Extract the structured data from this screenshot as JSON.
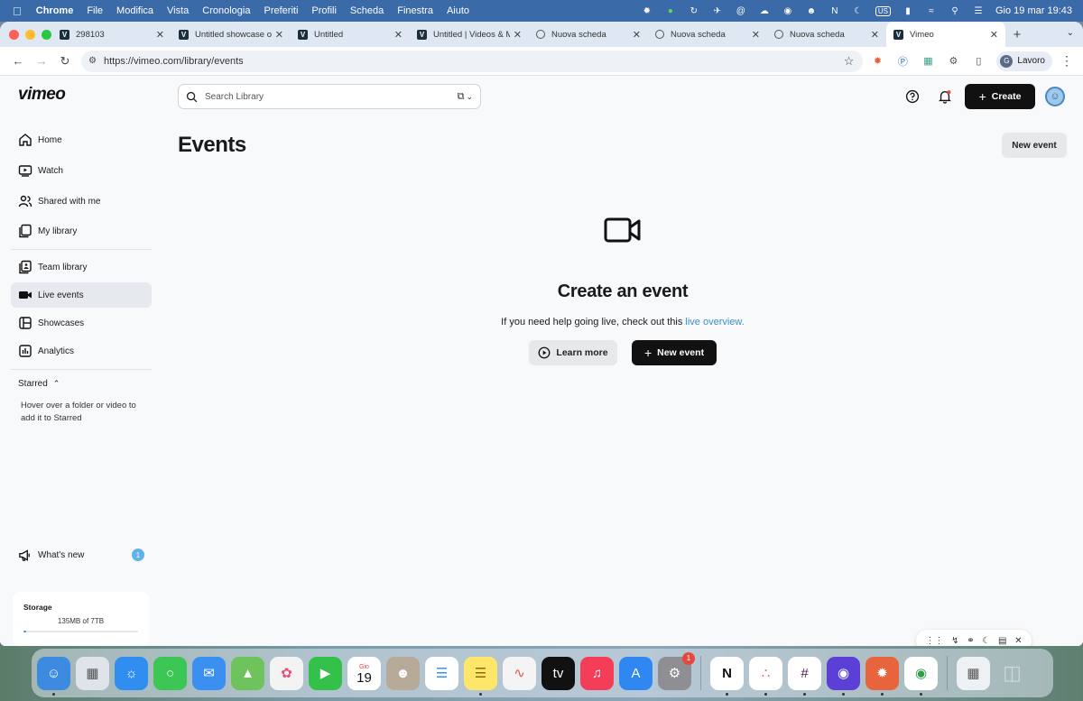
{
  "menubar": {
    "app": "Chrome",
    "items": [
      "File",
      "Modifica",
      "Vista",
      "Cronologia",
      "Preferiti",
      "Profili",
      "Scheda",
      "Finestra",
      "Aiuto"
    ],
    "input_source": "US",
    "datetime": "Gio 19 mar  19:43"
  },
  "tabs": [
    {
      "title": "298103",
      "favicon": "vimeo"
    },
    {
      "title": "Untitled showcase o",
      "favicon": "vimeo"
    },
    {
      "title": "Untitled",
      "favicon": "vimeo"
    },
    {
      "title": "Untitled | Videos & M",
      "favicon": "vimeo"
    },
    {
      "title": "Nuova scheda",
      "favicon": "chrome"
    },
    {
      "title": "Nuova scheda",
      "favicon": "chrome"
    },
    {
      "title": "Nuova scheda",
      "favicon": "chrome"
    },
    {
      "title": "Vimeo",
      "favicon": "vimeo",
      "active": true
    }
  ],
  "toolbar": {
    "url": "https://vimeo.com/library/events",
    "profile_initial": "G",
    "profile_name": "Lavoro"
  },
  "app": {
    "logo": "vimeo",
    "search_placeholder": "Search Library",
    "create_label": "Create"
  },
  "sidebar": {
    "items": [
      {
        "label": "Home",
        "icon": "home-icon"
      },
      {
        "label": "Watch",
        "icon": "play-icon"
      },
      {
        "label": "Shared with me",
        "icon": "people-icon"
      },
      {
        "label": "My library",
        "icon": "library-icon"
      },
      {
        "label": "Team library",
        "icon": "team-library-icon"
      },
      {
        "label": "Live events",
        "icon": "camera-icon",
        "active": true
      },
      {
        "label": "Showcases",
        "icon": "showcase-icon"
      },
      {
        "label": "Analytics",
        "icon": "analytics-icon"
      }
    ],
    "starred_label": "Starred",
    "starred_hint": "Hover over a folder or video to add it to Starred",
    "whats_new_label": "What's new",
    "whats_new_count": "1",
    "storage_label": "Storage",
    "storage_value": "135MB of 7TB",
    "storage_fraction": 0.02
  },
  "main": {
    "title": "Events",
    "new_event_label": "New event",
    "empty_title": "Create an event",
    "empty_desc": "If you need help going live, check out this ",
    "empty_link": "live overview.",
    "learn_more_label": "Learn more",
    "new_event_cta_label": "New event"
  },
  "dock": {
    "calendar_month": "Gio",
    "calendar_day": "19",
    "settings_badge": "1"
  },
  "colors": {
    "accent_link": "#3d8fc6",
    "primary_button": "#111111",
    "menubar": "#3b6aa8"
  }
}
